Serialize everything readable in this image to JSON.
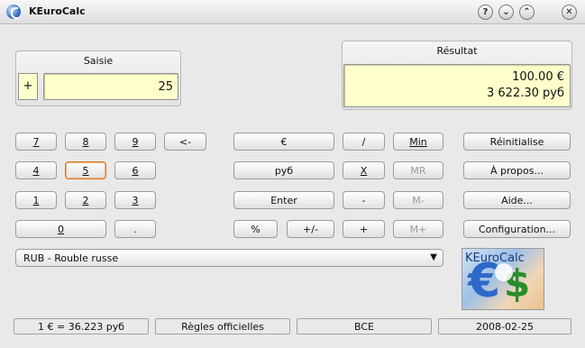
{
  "window": {
    "title": "KEuroCalc"
  },
  "titlebar_buttons": {
    "help": "?",
    "minimize": "⌄",
    "maximize": "⌃",
    "close": "✕"
  },
  "input": {
    "title": "Saisie",
    "sign": "+",
    "value": "25"
  },
  "result": {
    "title": "Résultat",
    "line1": "100.00 €",
    "line2": "3 622.30 руб"
  },
  "digits": {
    "d7": "7",
    "d8": "8",
    "d9": "9",
    "backspace": "<-",
    "d4": "4",
    "d5": "5",
    "d6": "6",
    "d1": "1",
    "d2": "2",
    "d3": "3",
    "d0": "0",
    "dot": "."
  },
  "ops": {
    "euro": "€",
    "rub": "руб",
    "enter": "Enter",
    "percent": "%",
    "plusminus": "+/-",
    "divide": "/",
    "multiply": "X",
    "minus": "-",
    "plus": "+",
    "min": "Min",
    "mr": "MR",
    "mminus": "M-",
    "mplus": "M+"
  },
  "actions": {
    "reset": "Réinitialise",
    "about": "À propos...",
    "help": "Aide...",
    "config": "Configuration..."
  },
  "currency": {
    "selected": "RUB - Rouble russe"
  },
  "logo": {
    "text": "KEuroCalc"
  },
  "statusbar": {
    "rate": "1 € = 36.223 руб",
    "rules": "Règles officielles",
    "source": "BCE",
    "date": "2008-02-25"
  }
}
